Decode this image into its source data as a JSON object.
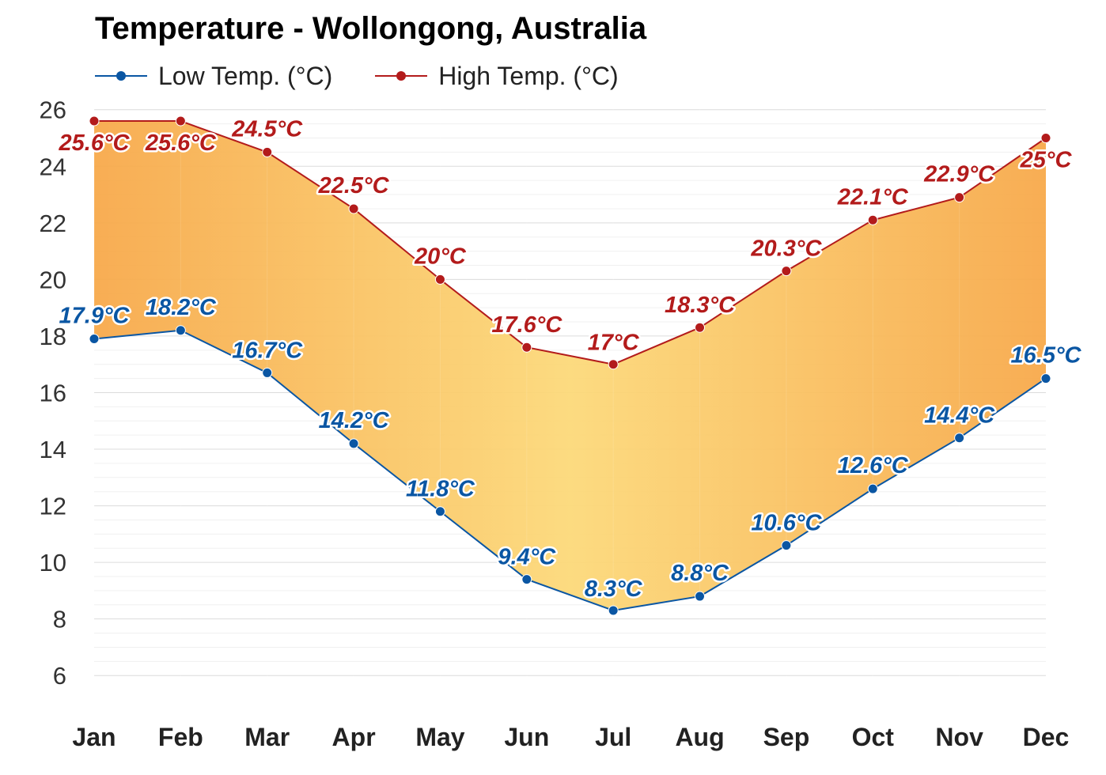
{
  "title": "Temperature - Wollongong, Australia",
  "legend": {
    "low_label": "Low Temp. (°C)",
    "high_label": "High Temp. (°C)"
  },
  "colors": {
    "low": "#0a56a3",
    "high": "#b31b1b",
    "fill_warm": "#f7a94b",
    "fill_cool": "#fcd97a",
    "grid": "#e6e6e6"
  },
  "chart_data": {
    "type": "area",
    "title": "Temperature - Wollongong, Australia",
    "categories": [
      "Jan",
      "Feb",
      "Mar",
      "Apr",
      "May",
      "Jun",
      "Jul",
      "Aug",
      "Sep",
      "Oct",
      "Nov",
      "Dec"
    ],
    "series": [
      {
        "name": "Low Temp. (°C)",
        "values": [
          17.9,
          18.2,
          16.7,
          14.2,
          11.8,
          9.4,
          8.3,
          8.8,
          10.6,
          12.6,
          14.4,
          16.5
        ],
        "labels": [
          "17.9°C",
          "18.2°C",
          "16.7°C",
          "14.2°C",
          "11.8°C",
          "9.4°C",
          "8.3°C",
          "8.8°C",
          "10.6°C",
          "12.6°C",
          "14.4°C",
          "16.5°C"
        ]
      },
      {
        "name": "High Temp. (°C)",
        "values": [
          25.6,
          25.6,
          24.5,
          22.5,
          20,
          17.6,
          17,
          18.3,
          20.3,
          22.1,
          22.9,
          25
        ],
        "labels": [
          "25.6°C",
          "25.6°C",
          "24.5°C",
          "22.5°C",
          "20°C",
          "17.6°C",
          "17°C",
          "18.3°C",
          "20.3°C",
          "22.1°C",
          "22.9°C",
          "25°C"
        ]
      }
    ],
    "y_ticks": [
      "6",
      "8",
      "10",
      "12",
      "14",
      "16",
      "18",
      "20",
      "22",
      "24",
      "26"
    ],
    "ylim": [
      5,
      26
    ],
    "grid": true,
    "legend_position": "top-left"
  }
}
